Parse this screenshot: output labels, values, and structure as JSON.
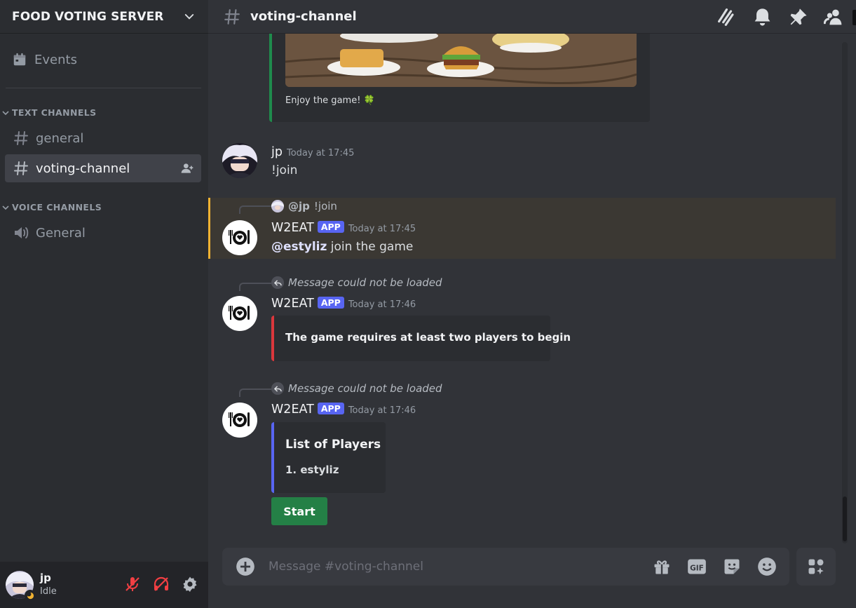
{
  "server": {
    "name": "FOOD VOTING SERVER"
  },
  "sidebar": {
    "events_label": "Events",
    "text_category": "TEXT CHANNELS",
    "voice_category": "VOICE CHANNELS",
    "text_channels": [
      {
        "label": "general",
        "active": false
      },
      {
        "label": "voting-channel",
        "active": true
      }
    ],
    "voice_channels": [
      {
        "label": "General"
      }
    ]
  },
  "user": {
    "name": "jp",
    "status": "Idle"
  },
  "channel": {
    "title": "voting-channel"
  },
  "messages": {
    "embed_top": {
      "text": "Enjoy the game! 🍀"
    },
    "m1": {
      "author": "jp",
      "time": "Today at 17:45",
      "content": "!join"
    },
    "m2": {
      "reply_author": "@jp",
      "reply_text": "!join",
      "author": "W2EAT",
      "tag": "APP",
      "time": "Today at 17:45",
      "mention": "@estyliz",
      "content": " join the game"
    },
    "m3": {
      "reply_text": "Message could not be loaded",
      "author": "W2EAT",
      "tag": "APP",
      "time": "Today at 17:46",
      "embed_text": "The game requires at least two players to begin"
    },
    "m4": {
      "reply_text": "Message could not be loaded",
      "author": "W2EAT",
      "tag": "APP",
      "time": "Today at 17:46",
      "embed_title": "List of Players",
      "embed_item": "1. estyliz",
      "button_label": "Start"
    }
  },
  "composer": {
    "placeholder": "Message #voting-channel"
  },
  "colors": {
    "accent": "#5865f2",
    "success": "#248046",
    "error": "#da373c",
    "mention_highlight": "#f0b232",
    "embed_green": "#1f8b4c"
  },
  "icons": {
    "server_header": "chevron-down-icon",
    "events": "calendar-icon",
    "channel": "hash-icon",
    "voice": "speaker-icon",
    "invite": "add-member-icon",
    "topbar": [
      "threads-icon",
      "bell-icon",
      "pin-icon",
      "members-icon"
    ],
    "user_controls": [
      "mic-muted-icon",
      "deafen-icon",
      "gear-icon"
    ],
    "composer": [
      "plus-icon",
      "gift-icon",
      "gif-icon",
      "sticker-icon",
      "emoji-icon",
      "apps-icon"
    ]
  }
}
